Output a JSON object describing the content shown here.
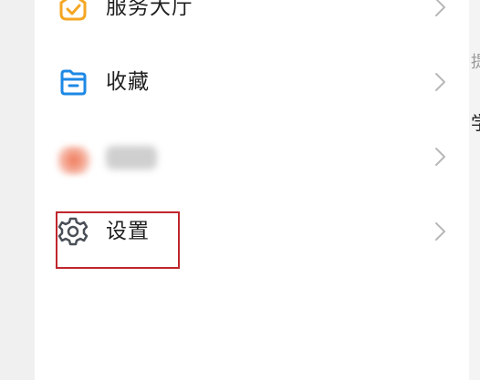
{
  "menu": {
    "items": [
      {
        "label": "服务大厅",
        "icon": "service-hall-icon"
      },
      {
        "label": "收藏",
        "icon": "folder-favorites-icon"
      },
      {
        "label": "",
        "icon": "blurred-app-icon"
      },
      {
        "label": "设置",
        "icon": "gear-icon"
      }
    ]
  },
  "right_edge": {
    "fragment_1": "提",
    "fragment_2": "学"
  },
  "colors": {
    "service_icon": "#f5a623",
    "favorites_icon": "#1e88e5",
    "settings_icon": "#4a4f57",
    "chevron": "#b8b8b8",
    "highlight": "#c0262d"
  }
}
